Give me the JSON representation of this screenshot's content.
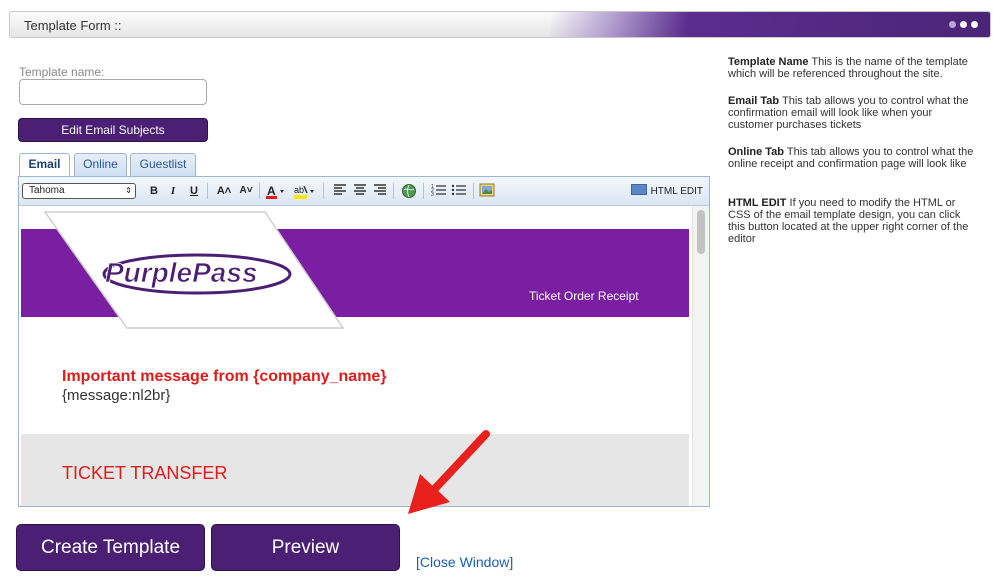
{
  "window": {
    "title": "Template Form ::"
  },
  "form": {
    "template_name_label": "Template name:",
    "template_name_value": "",
    "edit_subjects_label": "Edit Email Subjects"
  },
  "tabs": [
    {
      "label": "Email",
      "active": true
    },
    {
      "label": "Online",
      "active": false
    },
    {
      "label": "Guestlist",
      "active": false
    }
  ],
  "toolbar": {
    "font": "Tahoma",
    "bold": "B",
    "italic": "I",
    "underline": "U",
    "increase_size": "A˄",
    "decrease_size": "A˅",
    "html_edit": "HTML EDIT"
  },
  "email_preview": {
    "logo": "PurplePass",
    "receipt_title": "Ticket Order Receipt",
    "important_message": "Important message from {company_name}",
    "message_token": "{message:nl2br}",
    "transfer_heading": "TICKET TRANSFER",
    "banner_color": "#7b1fa2"
  },
  "buttons": {
    "create": "Create Template",
    "preview": "Preview",
    "close": "[Close Window]"
  },
  "help": [
    {
      "term": "Template Name",
      "text": " This is the name of the template which will be referenced throughout the site."
    },
    {
      "term": "Email Tab",
      "text": " This tab allows you to control what the confirmation email will look like when your customer purchases tickets"
    },
    {
      "term": "Online Tab",
      "text": " This tab allows you to control what the online receipt and confirmation page will look like"
    },
    {
      "term": "HTML EDIT",
      "text": " If you need to modify the HTML or CSS of the email template design, you can click this button located at the upper right corner of the editor"
    }
  ],
  "colors": {
    "accent": "#4b1f73",
    "arrow": "#e8201e",
    "link": "#1a5fb4"
  }
}
